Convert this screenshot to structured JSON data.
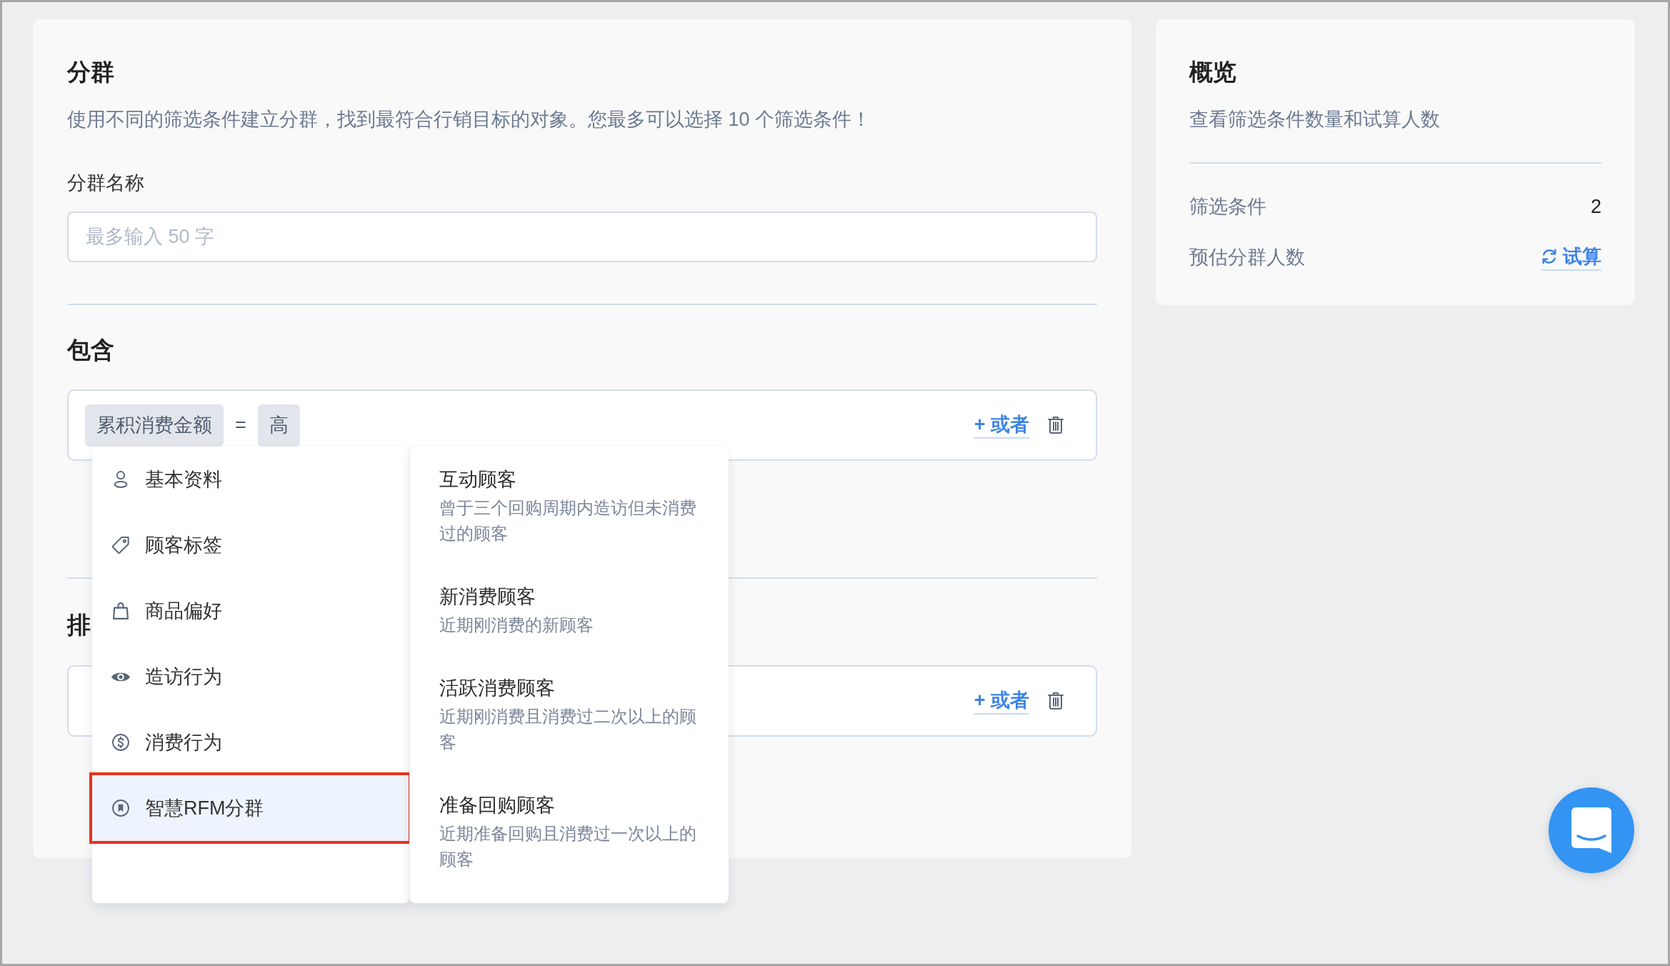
{
  "segment": {
    "title": "分群",
    "description": "使用不同的筛选条件建立分群，找到最符合行销目标的对象。您最多可以选择 10 个筛选条件！",
    "name_label": "分群名称",
    "name_input": {
      "placeholder": "最多输入 50 字"
    }
  },
  "include": {
    "title": "包含",
    "conditions": [
      {
        "field": "累积消费金额",
        "operator": "=",
        "value": "高"
      }
    ],
    "or_link": "+ 或者"
  },
  "exclude": {
    "title": "排",
    "or_link": "+ 或者"
  },
  "dropdown": {
    "categories": [
      {
        "label": "基本资料",
        "selected": false,
        "highlighted": false
      },
      {
        "label": "顾客标签",
        "selected": false,
        "highlighted": false
      },
      {
        "label": "商品偏好",
        "selected": false,
        "highlighted": false
      },
      {
        "label": "造访行为",
        "selected": false,
        "highlighted": false
      },
      {
        "label": "消费行为",
        "selected": false,
        "highlighted": false
      },
      {
        "label": "智慧RFM分群",
        "selected": true,
        "highlighted": true
      }
    ],
    "options": [
      {
        "title": "互动顾客",
        "description": "曾于三个回购周期内造访但未消费过的顾客"
      },
      {
        "title": "新消费顾客",
        "description": "近期刚消费的新顾客"
      },
      {
        "title": "活跃消费顾客",
        "description": "近期刚消费且消费过二次以上的顾客"
      },
      {
        "title": "准备回购顾客",
        "description": "近期准备回购且消费过一次以上的顾客"
      }
    ]
  },
  "overview": {
    "title": "概览",
    "description": "查看筛选条件数量和试算人数",
    "rows": [
      {
        "label": "筛选条件",
        "value": "2",
        "kind": "value"
      },
      {
        "label": "预估分群人数",
        "value": "试算",
        "kind": "action"
      }
    ]
  }
}
